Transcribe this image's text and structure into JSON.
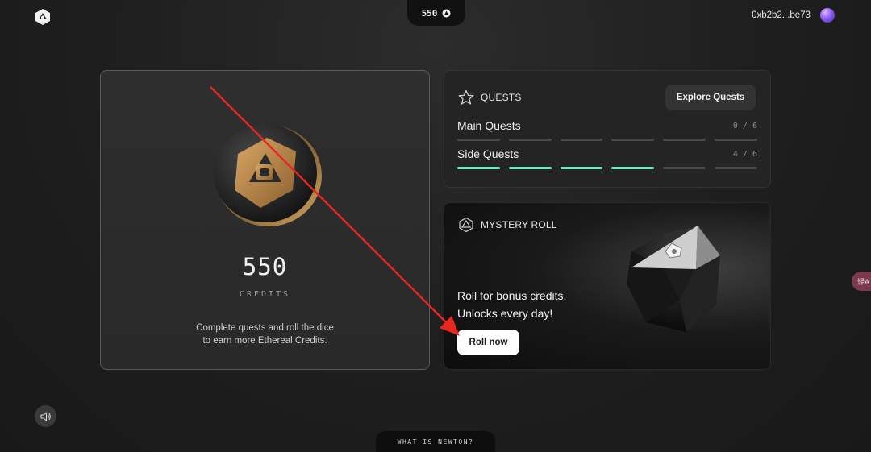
{
  "header": {
    "credits_value": "550",
    "wallet_address": "0xb2b2...be73"
  },
  "credits_card": {
    "amount": "550",
    "unit_label": "CREDITS",
    "description_line1": "Complete quests and roll the dice",
    "description_line2": "to earn more Ethereal Credits."
  },
  "quests_card": {
    "title": "QUESTS",
    "explore_button": "Explore Quests",
    "rows": [
      {
        "name": "Main Quests",
        "count": "0 / 6",
        "completed": 0,
        "total": 6
      },
      {
        "name": "Side Quests",
        "count": "4 / 6",
        "completed": 4,
        "total": 6
      }
    ],
    "progress_color": "#6ee7b7"
  },
  "mystery_card": {
    "title": "MYSTERY ROLL",
    "line1": "Roll for bonus credits.",
    "line2": "Unlocks every day!",
    "button": "Roll now"
  },
  "footer": {
    "what_is": "WHAT IS NEWTON?"
  },
  "side_widget": {
    "label": "译A"
  },
  "icons": [
    "newton-logo-icon",
    "credit-coin-icon",
    "star-icon",
    "dice-outline-icon",
    "speaker-icon"
  ],
  "annotation_color": "#e8271e"
}
